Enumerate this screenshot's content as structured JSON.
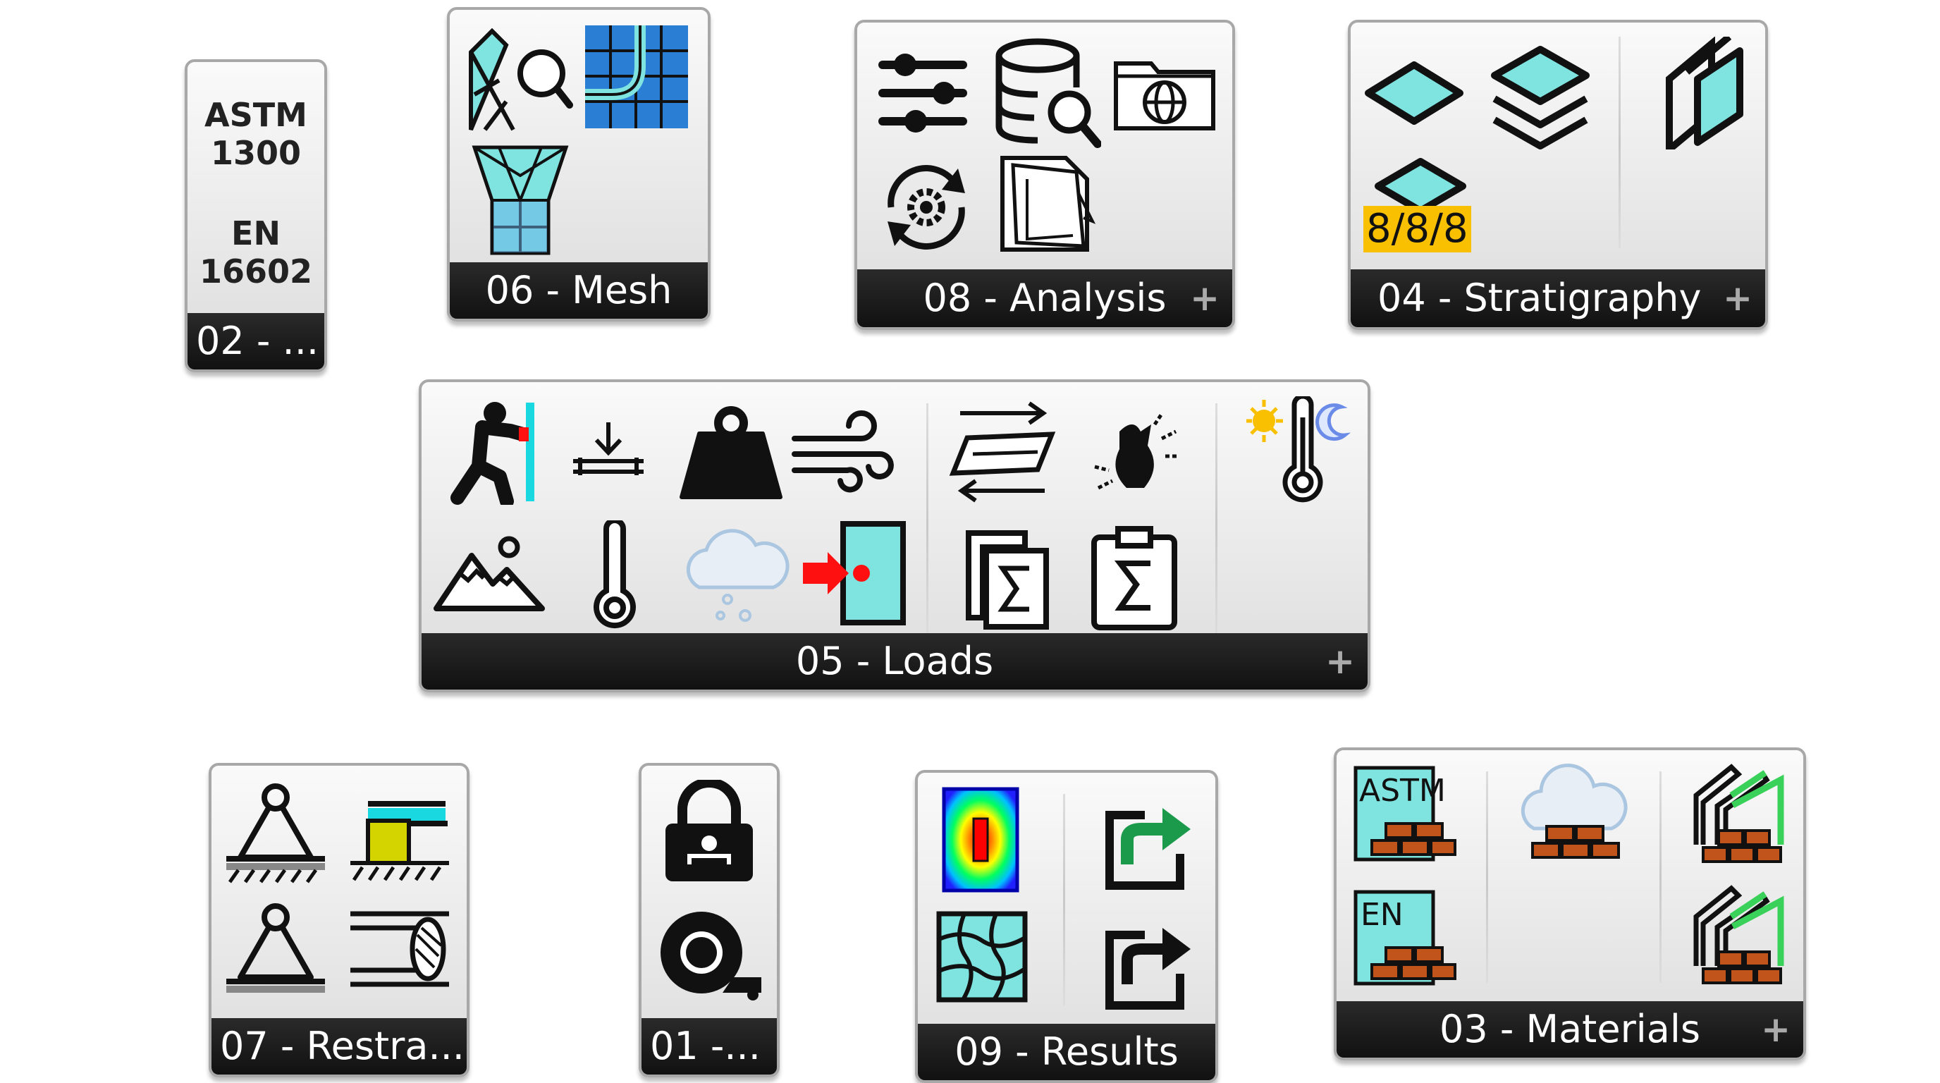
{
  "panels": {
    "standards": {
      "footer": "02 - ...",
      "lines": [
        "ASTM",
        "1300",
        "EN",
        "16602"
      ]
    },
    "mesh": {
      "footer": "06 - Mesh"
    },
    "analysis": {
      "footer": "08 - Analysis",
      "plus": "+"
    },
    "stratigraphy": {
      "footer": "04 - Stratigraphy",
      "plus": "+",
      "badge": "8/8/8"
    },
    "loads": {
      "footer": "05 - Loads",
      "plus": "+"
    },
    "restraints": {
      "footer": "07 -  Restra..."
    },
    "misc": {
      "footer": "01 -..."
    },
    "results": {
      "footer": "09 - Results"
    },
    "materials": {
      "footer": "03 - Materials",
      "plus": "+",
      "astm_label": "ASTM",
      "en_label": "EN"
    }
  },
  "colors": {
    "accent_cyan": "#7fe3e0",
    "mesh_blue": "#2a7fd4",
    "badge_yellow": "#f8c000",
    "arrow_green": "#1a9a4a",
    "brick": "#c0541a",
    "alert_red": "#ff1010"
  }
}
